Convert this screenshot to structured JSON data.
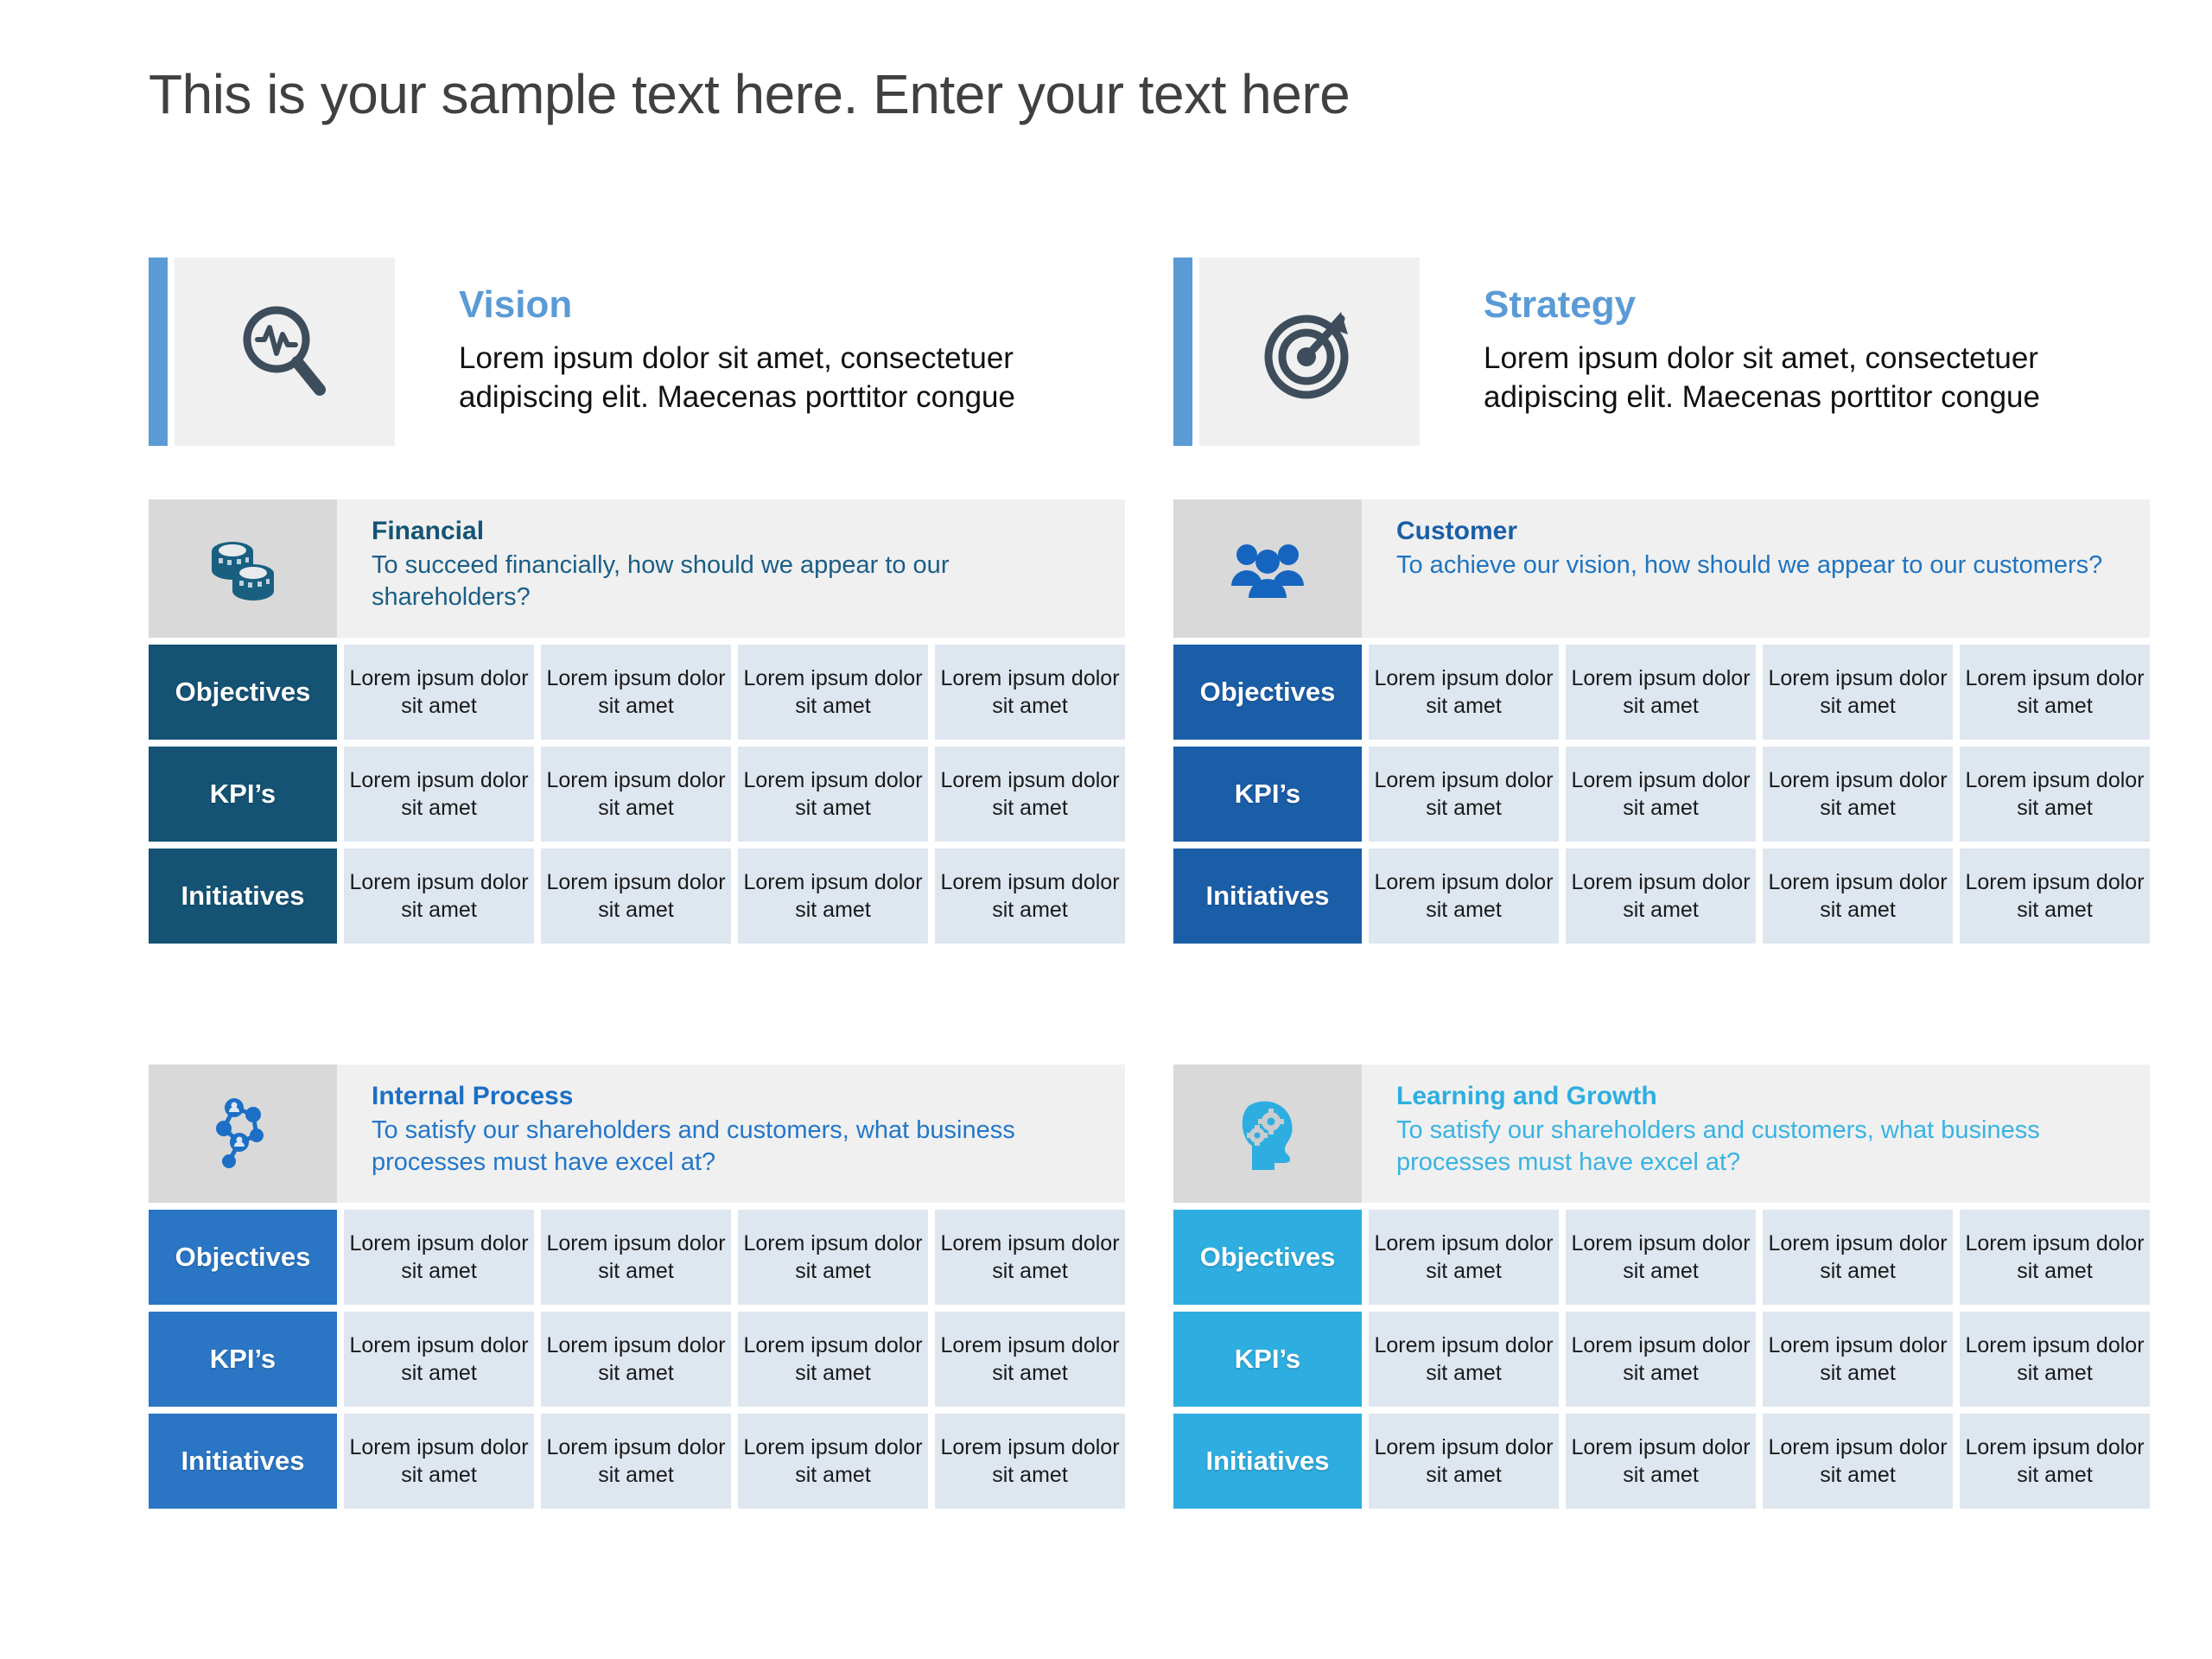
{
  "slide": {
    "title": "This is your sample text here. Enter your text here"
  },
  "colors": {
    "accent_bar": "#5B9BD5",
    "banner_title": "#5B9BD5",
    "financial": "#145374",
    "customer": "#1B5EA8",
    "internal": "#2A76C4",
    "learning": "#2EAEE0",
    "header_icon_bg": "#D9D9D9",
    "header_text_bg": "#F0F0F0",
    "cell_bg": "#DEE6F0",
    "title_text": "#404040"
  },
  "banners": [
    {
      "id": "vision",
      "title": "Vision",
      "body": "Lorem ipsum dolor sit amet, consectetuer adipiscing elit. Maecenas porttitor congue",
      "icon": "magnifier-pulse-icon"
    },
    {
      "id": "strategy",
      "title": "Strategy",
      "body": "Lorem ipsum dolor sit amet, consectetuer adipiscing elit. Maecenas porttitor congue",
      "icon": "target-arrow-icon"
    }
  ],
  "quadrants": [
    {
      "id": "financial",
      "name": "Financial",
      "question": "To succeed financially, how should we appear to our shareholders?",
      "icon": "coins-icon",
      "color": "#145374",
      "rows": [
        {
          "label": "Objectives",
          "cells": [
            "Lorem ipsum dolor sit amet",
            "Lorem ipsum dolor sit amet",
            "Lorem ipsum dolor sit amet",
            "Lorem ipsum dolor sit amet"
          ]
        },
        {
          "label": "KPI’s",
          "cells": [
            "Lorem ipsum dolor sit amet",
            "Lorem ipsum dolor sit amet",
            "Lorem ipsum dolor sit amet",
            "Lorem ipsum dolor sit amet"
          ]
        },
        {
          "label": "Initiatives",
          "cells": [
            "Lorem ipsum dolor sit amet",
            "Lorem ipsum dolor sit amet",
            "Lorem ipsum dolor sit amet",
            "Lorem ipsum dolor sit amet"
          ]
        }
      ]
    },
    {
      "id": "customer",
      "name": "Customer",
      "question": "To achieve our vision, how should we appear to our customers?",
      "icon": "people-group-icon",
      "color": "#1B5EA8",
      "rows": [
        {
          "label": "Objectives",
          "cells": [
            "Lorem ipsum dolor sit amet",
            "Lorem ipsum dolor sit amet",
            "Lorem ipsum dolor sit amet",
            "Lorem ipsum dolor sit amet"
          ]
        },
        {
          "label": "KPI’s",
          "cells": [
            "Lorem ipsum dolor sit amet",
            "Lorem ipsum dolor sit amet",
            "Lorem ipsum dolor sit amet",
            "Lorem ipsum dolor sit amet"
          ]
        },
        {
          "label": "Initiatives",
          "cells": [
            "Lorem ipsum dolor sit amet",
            "Lorem ipsum dolor sit amet",
            "Lorem ipsum dolor sit amet",
            "Lorem ipsum dolor sit amet"
          ]
        }
      ]
    },
    {
      "id": "internal",
      "name": "Internal Process",
      "question": "To satisfy our shareholders and customers, what business processes must have excel at?",
      "icon": "network-nodes-icon",
      "color": "#2A76C4",
      "rows": [
        {
          "label": "Objectives",
          "cells": [
            "Lorem ipsum dolor sit amet",
            "Lorem ipsum dolor sit amet",
            "Lorem ipsum dolor sit amet",
            "Lorem ipsum dolor sit amet"
          ]
        },
        {
          "label": "KPI’s",
          "cells": [
            "Lorem ipsum dolor sit amet",
            "Lorem ipsum dolor sit amet",
            "Lorem ipsum dolor sit amet",
            "Lorem ipsum dolor sit amet"
          ]
        },
        {
          "label": "Initiatives",
          "cells": [
            "Lorem ipsum dolor sit amet",
            "Lorem ipsum dolor sit amet",
            "Lorem ipsum dolor sit amet",
            "Lorem ipsum dolor sit amet"
          ]
        }
      ]
    },
    {
      "id": "learning",
      "name": "Learning and Growth",
      "question": "To satisfy our shareholders and customers, what business processes must have excel at?",
      "icon": "head-gears-icon",
      "color": "#2EAEE0",
      "rows": [
        {
          "label": "Objectives",
          "cells": [
            "Lorem ipsum dolor sit amet",
            "Lorem ipsum dolor sit amet",
            "Lorem ipsum dolor sit amet",
            "Lorem ipsum dolor sit amet"
          ]
        },
        {
          "label": "KPI’s",
          "cells": [
            "Lorem ipsum dolor sit amet",
            "Lorem ipsum dolor sit amet",
            "Lorem ipsum dolor sit amet",
            "Lorem ipsum dolor sit amet"
          ]
        },
        {
          "label": "Initiatives",
          "cells": [
            "Lorem ipsum dolor sit amet",
            "Lorem ipsum dolor sit amet",
            "Lorem ipsum dolor sit amet",
            "Lorem ipsum dolor sit amet"
          ]
        }
      ]
    }
  ]
}
